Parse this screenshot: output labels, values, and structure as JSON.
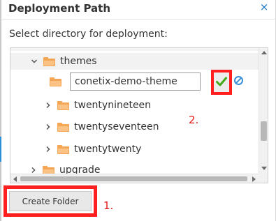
{
  "dialog": {
    "title": "Deployment Path",
    "close_symbol": "×",
    "prompt": "Select directory for deployment:"
  },
  "tree": {
    "items": [
      {
        "label": "themes",
        "expanded": true,
        "icon": "folder-icon"
      },
      {
        "label": "twentynineteen",
        "expanded": false,
        "icon": "folder-icon"
      },
      {
        "label": "twentyseventeen",
        "expanded": false,
        "icon": "folder-icon"
      },
      {
        "label": "twentytwenty",
        "expanded": false,
        "icon": "folder-icon"
      },
      {
        "label": "upgrade",
        "expanded": false,
        "icon": "folder-icon"
      }
    ],
    "new_folder": {
      "value": "conetix-demo-theme",
      "confirm_icon": "checkmark-icon",
      "cancel_icon": "cancel-icon"
    }
  },
  "buttons": {
    "create_folder": "Create Folder"
  },
  "annotations": {
    "step1": "1.",
    "step2": "2.",
    "highlight_color": "#ff1f1f"
  },
  "colors": {
    "folder": "#f5a655",
    "accent": "#1b76c2",
    "confirm": "#43a816"
  }
}
